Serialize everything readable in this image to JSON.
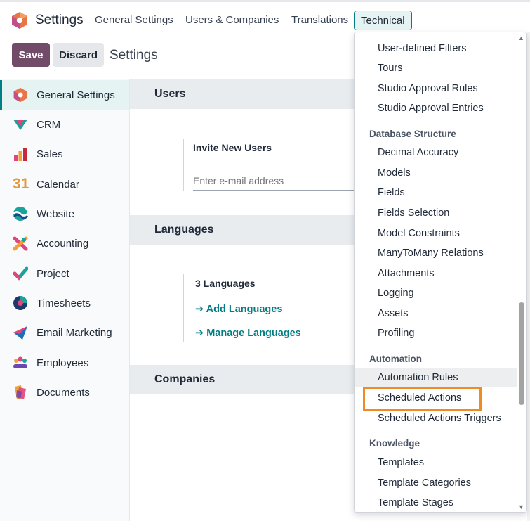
{
  "nav": {
    "app_title": "Settings",
    "menu": [
      "General Settings",
      "Users & Companies",
      "Translations",
      "Technical"
    ]
  },
  "actions": {
    "save": "Save",
    "discard": "Discard",
    "breadcrumb": "Settings"
  },
  "sidebar": {
    "items": [
      {
        "label": "General Settings",
        "icon": "settings-icon"
      },
      {
        "label": "CRM",
        "icon": "crm-icon"
      },
      {
        "label": "Sales",
        "icon": "sales-icon"
      },
      {
        "label": "Calendar",
        "icon": "calendar-icon",
        "icon_text": "31"
      },
      {
        "label": "Website",
        "icon": "website-icon"
      },
      {
        "label": "Accounting",
        "icon": "accounting-icon"
      },
      {
        "label": "Project",
        "icon": "project-icon"
      },
      {
        "label": "Timesheets",
        "icon": "timesheets-icon"
      },
      {
        "label": "Email Marketing",
        "icon": "email-marketing-icon"
      },
      {
        "label": "Employees",
        "icon": "employees-icon"
      },
      {
        "label": "Documents",
        "icon": "documents-icon"
      }
    ]
  },
  "main": {
    "users": {
      "title": "Users",
      "invite_label": "Invite New Users",
      "email_placeholder": "Enter e-mail address"
    },
    "languages": {
      "title": "Languages",
      "count_label": "3 Languages",
      "add_link": "Add Languages",
      "manage_link": "Manage Languages"
    },
    "companies": {
      "title": "Companies"
    }
  },
  "dropdown": {
    "group0_items": [
      "User-defined Filters",
      "Tours",
      "Studio Approval Rules",
      "Studio Approval Entries"
    ],
    "db_header": "Database Structure",
    "db_items": [
      "Decimal Accuracy",
      "Models",
      "Fields",
      "Fields Selection",
      "Model Constraints",
      "ManyToMany Relations",
      "Attachments",
      "Logging",
      "Assets",
      "Profiling"
    ],
    "auto_header": "Automation",
    "auto_items": [
      "Automation Rules",
      "Scheduled Actions",
      "Scheduled Actions Triggers"
    ],
    "knowledge_header": "Knowledge",
    "knowledge_items": [
      "Templates",
      "Template Categories",
      "Template Stages"
    ]
  },
  "colors": {
    "brand": "#714b67",
    "accent": "#017e84",
    "highlight": "#f08a24"
  }
}
